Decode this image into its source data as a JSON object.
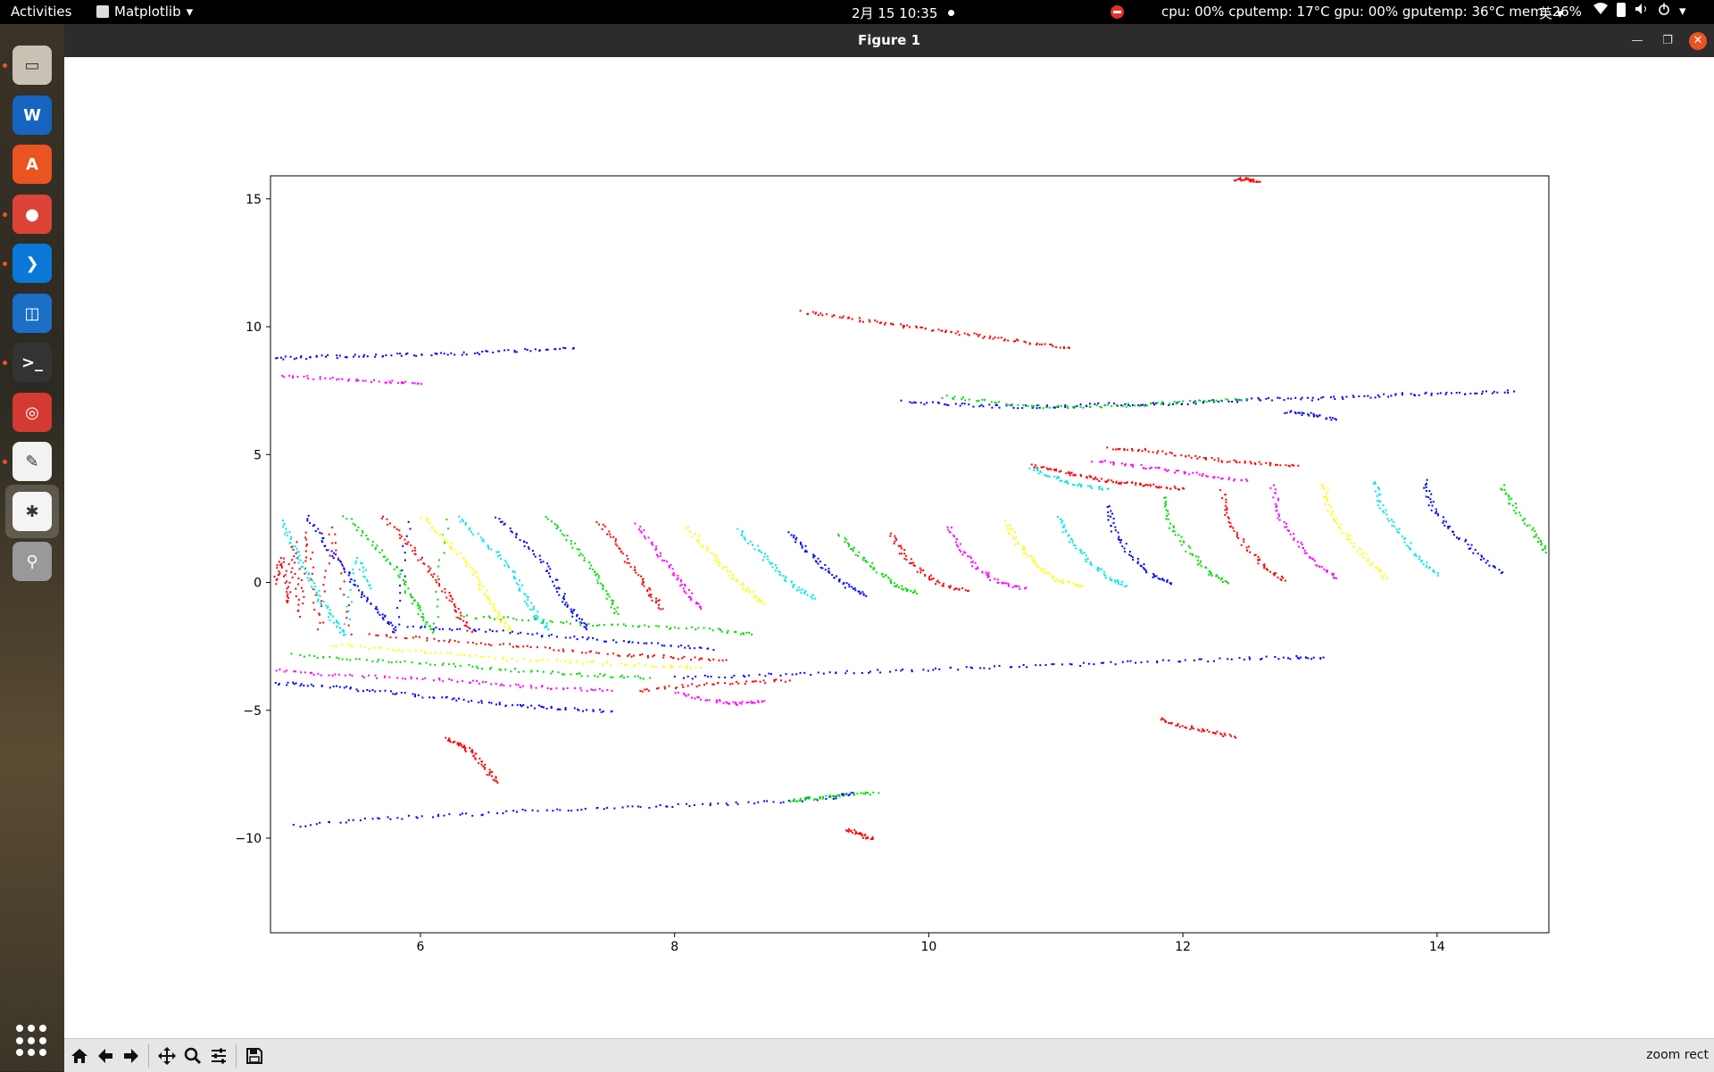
{
  "topbar": {
    "activities": "Activities",
    "app_menu": "Matplotlib",
    "clock": "2月 15  10:35",
    "sysmon": "cpu: 00% cputemp: 17°C gpu: 00% gputemp: 36°C mem: 26%",
    "ime": "英"
  },
  "dock": {
    "items": [
      {
        "name": "files",
        "color": "#c9c2b4"
      },
      {
        "name": "writer",
        "color": "#1565c0"
      },
      {
        "name": "software",
        "color": "#e95420"
      },
      {
        "name": "chrome",
        "color": "#db4437"
      },
      {
        "name": "vscode",
        "color": "#0a78d7"
      },
      {
        "name": "virtualbox",
        "color": "#1b6fc5"
      },
      {
        "name": "terminal",
        "color": "#333333"
      },
      {
        "name": "netease-music",
        "color": "#d33a31"
      },
      {
        "name": "text-editor",
        "color": "#f2f2f2"
      },
      {
        "name": "matplotlib",
        "color": "#f4f4f4"
      },
      {
        "name": "usb",
        "color": "#999999"
      }
    ]
  },
  "window": {
    "title": "Figure 1"
  },
  "toolbar": {
    "status": "zoom rect"
  },
  "chart_data": {
    "type": "scatter",
    "title": "",
    "xlabel": "",
    "ylabel": "",
    "xlim": [
      4.82,
      14.88
    ],
    "ylim": [
      -13.7,
      15.9
    ],
    "xticks": [
      6,
      8,
      10,
      12,
      14
    ],
    "yticks": [
      15,
      10,
      5,
      0,
      -5,
      -10
    ],
    "grid": false,
    "legend": "none",
    "colors": [
      "#ff0000",
      "#00dd00",
      "#0000ff",
      "#00e6e6",
      "#ff00ff",
      "#ffff00"
    ],
    "series": [
      {
        "color": "#ff0000",
        "x": [
          4.85,
          4.9,
          4.95,
          5.0,
          5.05,
          5.1,
          5.2,
          5.3,
          5.45
        ],
        "y": [
          0.0,
          1.0,
          -0.8,
          1.6,
          -1.3,
          2.0,
          -1.8,
          2.2,
          -2.0
        ]
      },
      {
        "color": "#00e6e6",
        "x": [
          4.9,
          5.0,
          5.1,
          5.2,
          5.3,
          5.4,
          5.5,
          5.6
        ],
        "y": [
          2.4,
          1.4,
          0.4,
          -0.6,
          -1.4,
          -2.0,
          1.0,
          -0.2
        ]
      },
      {
        "color": "#0000ff",
        "x": [
          5.1,
          5.25,
          5.4,
          5.55,
          5.7,
          5.8,
          5.9
        ],
        "y": [
          2.6,
          1.5,
          0.5,
          -0.5,
          -1.3,
          -1.9,
          2.4
        ]
      },
      {
        "color": "#00dd00",
        "x": [
          5.4,
          5.6,
          5.8,
          5.9,
          6.0,
          6.1,
          6.2
        ],
        "y": [
          2.6,
          1.6,
          0.6,
          -0.4,
          -1.2,
          -1.9,
          2.5
        ]
      },
      {
        "color": "#ff0000",
        "x": [
          5.7,
          5.9,
          6.05,
          6.2,
          6.3,
          6.4
        ],
        "y": [
          2.6,
          1.6,
          0.6,
          -0.4,
          -1.2,
          -1.9
        ]
      },
      {
        "color": "#ffff00",
        "x": [
          6.0,
          6.2,
          6.4,
          6.5,
          6.6,
          6.7
        ],
        "y": [
          2.6,
          1.6,
          0.6,
          -0.4,
          -1.2,
          -1.9
        ]
      },
      {
        "color": "#00e6e6",
        "x": [
          6.3,
          6.5,
          6.7,
          6.8,
          6.9,
          7.0
        ],
        "y": [
          2.6,
          1.6,
          0.6,
          -0.4,
          -1.2,
          -1.8
        ]
      },
      {
        "color": "#0000ff",
        "x": [
          6.6,
          6.8,
          7.0,
          7.1,
          7.2,
          7.3
        ],
        "y": [
          2.6,
          1.6,
          0.6,
          -0.4,
          -1.2,
          -1.8
        ]
      },
      {
        "color": "#00dd00",
        "x": [
          7.0,
          7.2,
          7.35,
          7.45,
          7.55
        ],
        "y": [
          2.6,
          1.5,
          0.5,
          -0.4,
          -1.2
        ]
      },
      {
        "color": "#ff0000",
        "x": [
          7.4,
          7.55,
          7.7,
          7.8,
          7.9
        ],
        "y": [
          2.4,
          1.4,
          0.4,
          -0.4,
          -1.0
        ]
      },
      {
        "color": "#ff00ff",
        "x": [
          7.7,
          7.85,
          8.0,
          8.1,
          8.2
        ],
        "y": [
          2.3,
          1.3,
          0.3,
          -0.4,
          -1.0
        ]
      },
      {
        "color": "#ffff00",
        "x": [
          8.1,
          8.25,
          8.4,
          8.55,
          8.7
        ],
        "y": [
          2.2,
          1.3,
          0.5,
          -0.2,
          -0.8
        ]
      },
      {
        "color": "#00e6e6",
        "x": [
          8.5,
          8.65,
          8.8,
          8.95,
          9.1
        ],
        "y": [
          2.1,
          1.3,
          0.5,
          -0.2,
          -0.6
        ]
      },
      {
        "color": "#0000ff",
        "x": [
          8.9,
          9.05,
          9.2,
          9.35,
          9.5
        ],
        "y": [
          2.0,
          1.2,
          0.5,
          -0.1,
          -0.5
        ]
      },
      {
        "color": "#00dd00",
        "x": [
          9.3,
          9.45,
          9.6,
          9.75,
          9.9
        ],
        "y": [
          1.9,
          1.1,
          0.4,
          -0.1,
          -0.4
        ]
      },
      {
        "color": "#ff0000",
        "x": [
          9.7,
          9.8,
          9.95,
          10.1,
          10.3
        ],
        "y": [
          1.9,
          1.1,
          0.4,
          -0.1,
          -0.3
        ]
      },
      {
        "color": "#ff00ff",
        "x": [
          10.15,
          10.25,
          10.4,
          10.55,
          10.75
        ],
        "y": [
          2.2,
          1.3,
          0.5,
          0.0,
          -0.2
        ]
      },
      {
        "color": "#ffff00",
        "x": [
          10.6,
          10.7,
          10.85,
          11.0,
          11.2
        ],
        "y": [
          2.4,
          1.5,
          0.7,
          0.1,
          -0.1
        ]
      },
      {
        "color": "#00e6e6",
        "x": [
          11.0,
          11.1,
          11.25,
          11.4,
          11.55
        ],
        "y": [
          2.6,
          1.7,
          0.9,
          0.2,
          -0.1
        ]
      },
      {
        "color": "#0000ff",
        "x": [
          11.4,
          11.45,
          11.6,
          11.75,
          11.9
        ],
        "y": [
          3.0,
          2.0,
          1.0,
          0.3,
          0.0
        ]
      },
      {
        "color": "#00dd00",
        "x": [
          11.85,
          11.9,
          12.05,
          12.2,
          12.35
        ],
        "y": [
          3.4,
          2.2,
          1.2,
          0.4,
          0.0
        ]
      },
      {
        "color": "#ff0000",
        "x": [
          12.3,
          12.35,
          12.5,
          12.65,
          12.8
        ],
        "y": [
          3.6,
          2.4,
          1.4,
          0.6,
          0.1
        ]
      },
      {
        "color": "#ff00ff",
        "x": [
          12.7,
          12.75,
          12.9,
          13.05,
          13.2
        ],
        "y": [
          3.8,
          2.6,
          1.6,
          0.7,
          0.2
        ]
      },
      {
        "color": "#ffff00",
        "x": [
          13.1,
          13.15,
          13.3,
          13.45,
          13.6
        ],
        "y": [
          3.9,
          2.8,
          1.8,
          0.9,
          0.2
        ]
      },
      {
        "color": "#00e6e6",
        "x": [
          13.5,
          13.55,
          13.7,
          13.85,
          14.0
        ],
        "y": [
          4.0,
          3.0,
          2.0,
          1.0,
          0.3
        ]
      },
      {
        "color": "#0000ff",
        "x": [
          13.9,
          13.95,
          14.1,
          14.3,
          14.5
        ],
        "y": [
          4.0,
          3.0,
          2.1,
          1.2,
          0.4
        ]
      },
      {
        "color": "#00dd00",
        "x": [
          14.5,
          14.6,
          14.75,
          14.85
        ],
        "y": [
          3.8,
          3.0,
          2.0,
          1.2
        ]
      },
      {
        "color": "#0000ff",
        "x": [
          4.85,
          5.2,
          5.6,
          6.0,
          6.4,
          6.8,
          7.1,
          7.5
        ],
        "y": [
          -3.9,
          -4.0,
          -4.2,
          -4.4,
          -4.6,
          -4.8,
          -4.9,
          -5.0
        ]
      },
      {
        "color": "#ff00ff",
        "x": [
          4.85,
          5.3,
          5.8,
          6.3,
          6.7,
          7.1,
          7.5
        ],
        "y": [
          -3.4,
          -3.6,
          -3.7,
          -3.8,
          -4.0,
          -4.1,
          -4.2
        ]
      },
      {
        "color": "#00dd00",
        "x": [
          5.0,
          5.5,
          6.0,
          6.5,
          7.0,
          7.4,
          7.8
        ],
        "y": [
          -2.8,
          -3.0,
          -3.1,
          -3.3,
          -3.5,
          -3.6,
          -3.7
        ]
      },
      {
        "color": "#ffff00",
        "x": [
          5.3,
          5.8,
          6.3,
          6.8,
          7.3,
          7.8,
          8.2
        ],
        "y": [
          -2.4,
          -2.6,
          -2.8,
          -3.0,
          -3.1,
          -3.2,
          -3.3
        ]
      },
      {
        "color": "#ff0000",
        "x": [
          5.6,
          6.1,
          6.6,
          7.1,
          7.6,
          8.0,
          8.4
        ],
        "y": [
          -2.0,
          -2.2,
          -2.4,
          -2.6,
          -2.8,
          -2.9,
          -3.0
        ]
      },
      {
        "color": "#0000ff",
        "x": [
          5.9,
          6.4,
          6.9,
          7.4,
          7.9,
          8.3
        ],
        "y": [
          -1.7,
          -1.8,
          -2.0,
          -2.2,
          -2.4,
          -2.6
        ]
      },
      {
        "color": "#00dd00",
        "x": [
          6.3,
          6.8,
          7.3,
          7.8,
          8.3,
          8.6
        ],
        "y": [
          -1.3,
          -1.4,
          -1.6,
          -1.7,
          -1.8,
          -2.0
        ]
      },
      {
        "color": "#0000ff",
        "x": [
          8.0,
          8.6,
          9.2,
          9.8,
          10.4,
          11.0,
          11.6,
          12.2,
          12.8,
          13.1
        ],
        "y": [
          -3.7,
          -3.6,
          -3.5,
          -3.4,
          -3.3,
          -3.2,
          -3.1,
          -3.0,
          -2.9,
          -2.9
        ]
      },
      {
        "color": "#ff0000",
        "x": [
          7.7,
          8.1,
          8.5,
          8.9
        ],
        "y": [
          -4.2,
          -4.0,
          -3.9,
          -3.8
        ]
      },
      {
        "color": "#ff00ff",
        "x": [
          8.0,
          8.3,
          8.5,
          8.7
        ],
        "y": [
          -4.3,
          -4.6,
          -4.7,
          -4.6
        ]
      },
      {
        "color": "#0000ff",
        "x": [
          5.0,
          5.6,
          6.2,
          6.8,
          7.4,
          8.0,
          8.6,
          9.2,
          9.4
        ],
        "y": [
          -9.5,
          -9.2,
          -9.1,
          -8.9,
          -8.8,
          -8.7,
          -8.6,
          -8.4,
          -8.2
        ]
      },
      {
        "color": "#00dd00",
        "x": [
          8.9,
          9.1,
          9.3,
          9.6
        ],
        "y": [
          -8.5,
          -8.4,
          -8.3,
          -8.2
        ]
      },
      {
        "color": "#ff0000",
        "x": [
          9.35,
          9.45,
          9.55
        ],
        "y": [
          -9.6,
          -9.8,
          -10.0
        ]
      },
      {
        "color": "#ff0000",
        "x": [
          6.2,
          6.3,
          6.4,
          6.5,
          6.6
        ],
        "y": [
          -6.1,
          -6.3,
          -6.6,
          -7.2,
          -7.8
        ]
      },
      {
        "color": "#0000ff",
        "x": [
          4.85,
          5.2,
          5.6,
          6.0,
          6.4,
          6.8,
          7.2
        ],
        "y": [
          8.8,
          8.85,
          8.9,
          8.95,
          9.0,
          9.1,
          9.2
        ]
      },
      {
        "color": "#ff00ff",
        "x": [
          4.9,
          5.3,
          5.7,
          6.0
        ],
        "y": [
          8.1,
          8.0,
          7.9,
          7.8
        ]
      },
      {
        "color": "#ff0000",
        "x": [
          9.0,
          9.3,
          9.6,
          9.9,
          10.2,
          10.5,
          10.8,
          11.1
        ],
        "y": [
          10.6,
          10.4,
          10.2,
          10.0,
          9.8,
          9.6,
          9.4,
          9.2
        ]
      },
      {
        "color": "#0000ff",
        "x": [
          9.8,
          10.2,
          10.6,
          11.0,
          11.4,
          11.8,
          12.2,
          12.6,
          13.0,
          13.4,
          13.8,
          14.2,
          14.6
        ],
        "y": [
          7.1,
          7.0,
          6.9,
          6.9,
          7.0,
          7.0,
          7.1,
          7.2,
          7.2,
          7.3,
          7.4,
          7.4,
          7.5
        ]
      },
      {
        "color": "#00dd00",
        "x": [
          10.1,
          10.5,
          10.9,
          11.3,
          11.7,
          12.1,
          12.5
        ],
        "y": [
          7.3,
          7.1,
          6.9,
          6.9,
          7.0,
          7.1,
          7.2
        ]
      },
      {
        "color": "#ff0000",
        "x": [
          10.8,
          11.0,
          11.2,
          11.4,
          11.6,
          11.8,
          12.0
        ],
        "y": [
          4.6,
          4.4,
          4.2,
          4.0,
          3.9,
          3.8,
          3.7
        ]
      },
      {
        "color": "#00e6e6",
        "x": [
          10.8,
          11.0,
          11.2,
          11.4
        ],
        "y": [
          4.5,
          4.1,
          3.8,
          3.7
        ]
      },
      {
        "color": "#ff00ff",
        "x": [
          11.3,
          11.6,
          11.9,
          12.2,
          12.5
        ],
        "y": [
          4.8,
          4.6,
          4.4,
          4.2,
          4.0
        ]
      },
      {
        "color": "#ff0000",
        "x": [
          11.4,
          11.7,
          12.0,
          12.3,
          12.6,
          12.9
        ],
        "y": [
          5.3,
          5.2,
          5.0,
          4.8,
          4.7,
          4.6
        ]
      },
      {
        "color": "#0000ff",
        "x": [
          12.8,
          13.0,
          13.2
        ],
        "y": [
          6.7,
          6.6,
          6.4
        ]
      },
      {
        "color": "#ff0000",
        "x": [
          11.8,
          12.0,
          12.2,
          12.4
        ],
        "y": [
          -5.3,
          -5.6,
          -5.8,
          -6.0
        ]
      },
      {
        "color": "#ff0000",
        "x": [
          12.4,
          12.5,
          12.6
        ],
        "y": [
          15.8,
          15.8,
          15.7
        ]
      }
    ]
  }
}
